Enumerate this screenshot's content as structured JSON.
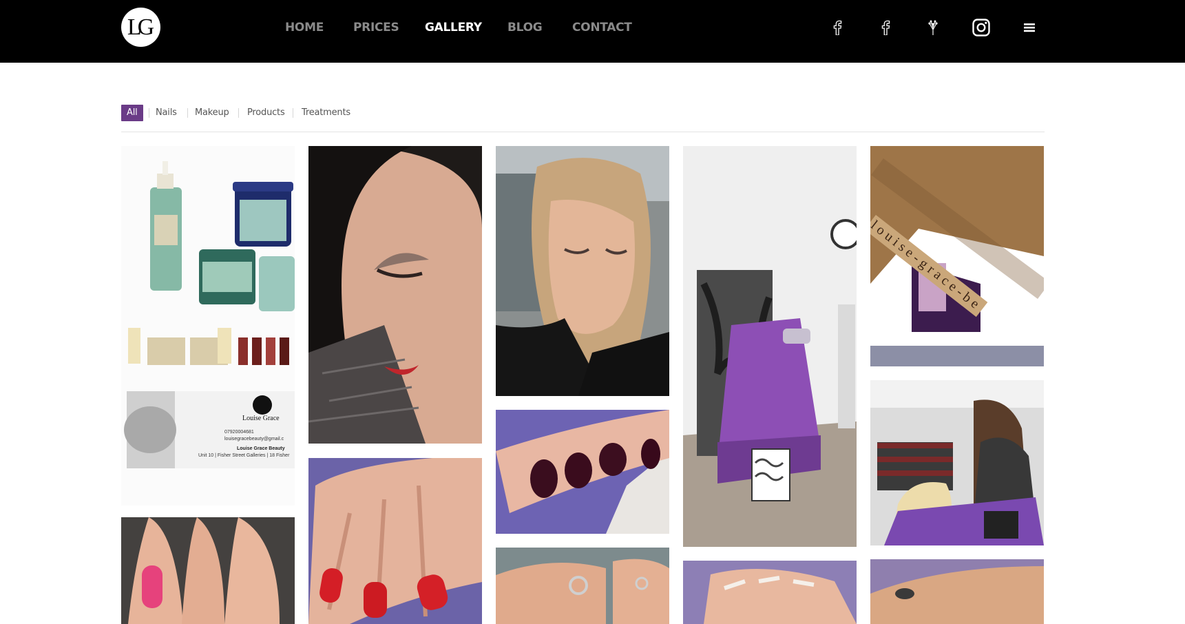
{
  "header": {
    "logo_text": "LG",
    "nav": [
      {
        "label": "HOME",
        "active": false
      },
      {
        "label": "PRICES",
        "active": false
      },
      {
        "label": "GALLERY",
        "active": true
      },
      {
        "label": "BLOG",
        "active": false
      },
      {
        "label": "CONTACT",
        "active": false
      }
    ],
    "social_icons": [
      "facebook-icon",
      "facebook-icon",
      "lavender-icon",
      "instagram-icon",
      "hamburger-menu-icon"
    ]
  },
  "filters": [
    {
      "label": "All",
      "active": true
    },
    {
      "label": "Nails",
      "active": false
    },
    {
      "label": "Makeup",
      "active": false
    },
    {
      "label": "Products",
      "active": false
    },
    {
      "label": "Treatments",
      "active": false
    }
  ],
  "gallery": {
    "business_card": {
      "name": "Louise Grace",
      "phone": "07920004681",
      "email": "louisegracebeauty@gmail.c",
      "business": "Louise Grace Beauty",
      "address": "Unit 10 | Fisher Street Galleries | 18 Fisher"
    },
    "banner_text": "louise-grace-be"
  },
  "colors": {
    "accent": "#6a3b87",
    "header_bg": "#000000",
    "nav_inactive": "#8a8a8a",
    "nav_active": "#ffffff"
  }
}
